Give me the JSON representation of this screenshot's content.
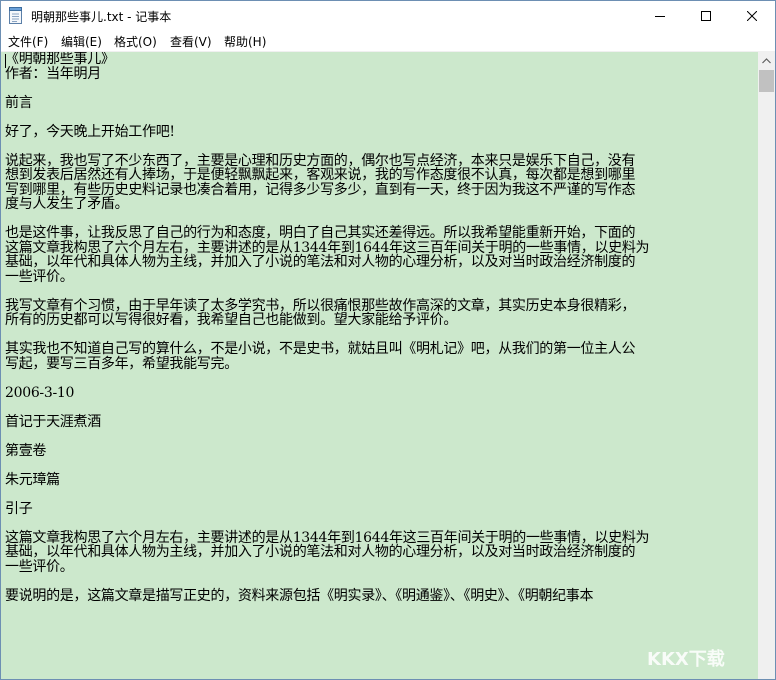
{
  "window": {
    "title": "明朝那些事儿.txt - 记事本",
    "controls": [
      "minimize-icon",
      "maximize-icon",
      "close-icon"
    ]
  },
  "menu": [
    "文件(F)",
    "编辑(E)",
    "格式(O)",
    "查看(V)",
    "帮助(H)"
  ],
  "document": {
    "lines": [
      "《明朝那些事儿》",
      "作者：当年明月",
      "",
      "前言",
      "",
      "好了，今天晚上开始工作吧!",
      "",
      "说起来，我也写了不少东西了，主要是心理和历史方面的，偶尔也写点经济，本来只是娱乐下自己，没有",
      "想到发表后居然还有人捧场，于是便轻飘飘起来，客观来说，我的写作态度很不认真，每次都是想到哪里",
      "写到哪里，有些历史史料记录也凑合着用，记得多少写多少，直到有一天，终于因为我这不严谨的写作态",
      "度与人发生了矛盾。",
      "",
      "也是这件事，让我反思了自己的行为和态度，明白了自己其实还差得远。所以我希望能重新开始，下面的",
      "这篇文章我构思了六个月左右，主要讲述的是从1344年到1644年这三百年间关于明的一些事情，以史料为",
      "基础，以年代和具体人物为主线，并加入了小说的笔法和对人物的心理分析，以及对当时政治经济制度的",
      "一些评价。",
      "",
      "我写文章有个习惯，由于早年读了太多学究书，所以很痛恨那些故作高深的文章，其实历史本身很精彩，",
      "所有的历史都可以写得很好看，我希望自己也能做到。望大家能给予评价。",
      "",
      "其实我也不知道自己写的算什么，不是小说，不是史书，就姑且叫《明札记》吧，从我们的第一位主人公",
      "写起，要写三百多年，希望我能写完。",
      "",
      "2006-3-10",
      "",
      "首记于天涯煮酒",
      "",
      "第壹卷",
      "",
      "朱元璋篇",
      "",
      "引子",
      "",
      "这篇文章我构思了六个月左右，主要讲述的是从1344年到1644年这三百年间关于明的一些事情，以史料为",
      "基础，以年代和具体人物为主线，并加入了小说的笔法和对人物的心理分析，以及对当时政治经济制度的",
      "一些评价。",
      "",
      "要说明的是，这篇文章是描写正史的，资料来源包括《明实录》、《明通鉴》、《明史》、《明朝纪事本"
    ]
  },
  "watermark": "KKX下载",
  "colors": {
    "editor_bg": "#cce8cc",
    "titlebar_bg": "#ffffff",
    "scrollbar_bg": "#f0f0f0"
  }
}
